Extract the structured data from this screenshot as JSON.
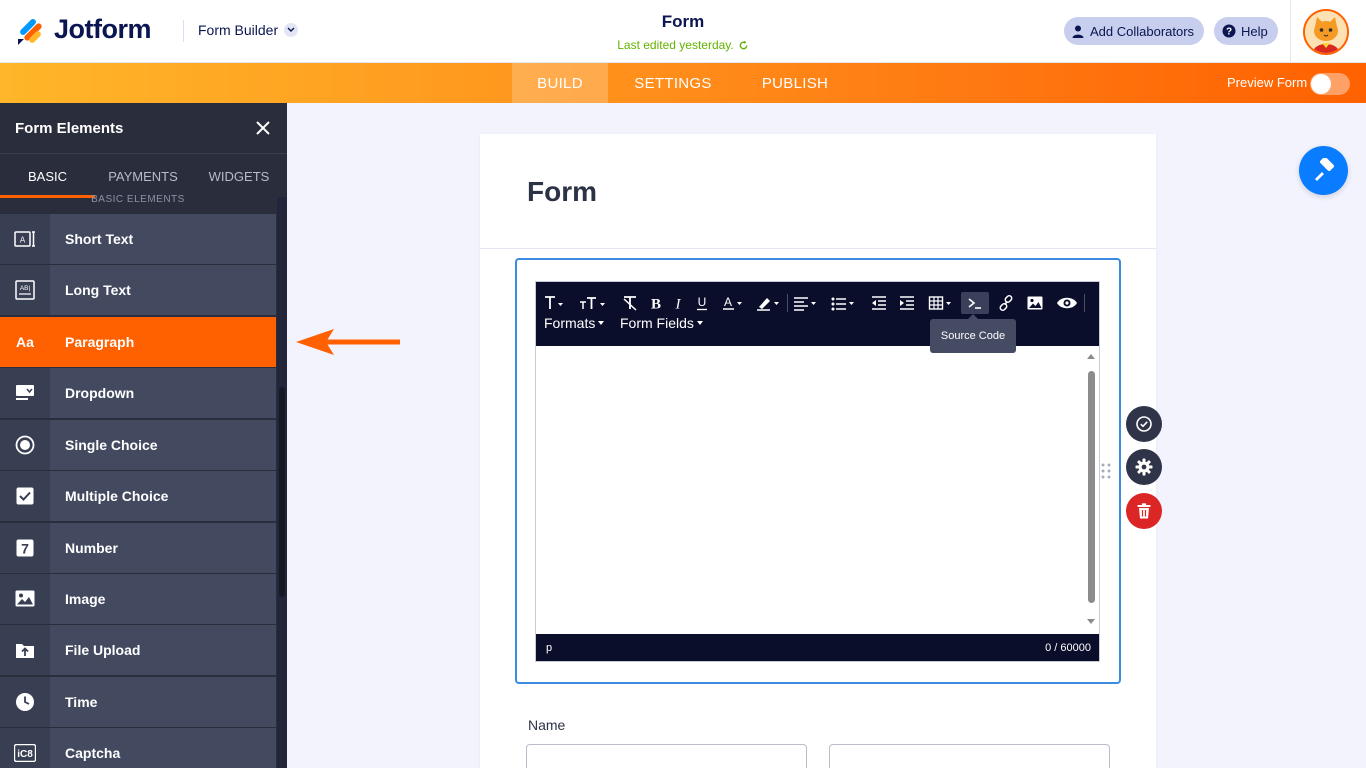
{
  "header": {
    "brand": "Jotform",
    "builder_label": "Form Builder",
    "form_title": "Form",
    "last_edited": "Last edited yesterday.",
    "add_collaborators": "Add Collaborators",
    "help": "Help"
  },
  "nav": {
    "tabs": [
      {
        "label": "BUILD",
        "active": true
      },
      {
        "label": "SETTINGS",
        "active": false
      },
      {
        "label": "PUBLISH",
        "active": false
      }
    ],
    "preview_label": "Preview Form",
    "preview_enabled": false
  },
  "sidebar": {
    "title": "Form Elements",
    "tabs": [
      {
        "label": "BASIC",
        "active": true
      },
      {
        "label": "PAYMENTS",
        "active": false
      },
      {
        "label": "WIDGETS",
        "active": false
      }
    ],
    "section_label": "BASIC ELEMENTS",
    "items": [
      {
        "label": "Short Text",
        "icon": "short-text-icon"
      },
      {
        "label": "Long Text",
        "icon": "long-text-icon"
      },
      {
        "label": "Paragraph",
        "icon": "paragraph-icon",
        "active": true
      },
      {
        "label": "Dropdown",
        "icon": "dropdown-icon"
      },
      {
        "label": "Single Choice",
        "icon": "radio-icon"
      },
      {
        "label": "Multiple Choice",
        "icon": "checkbox-icon"
      },
      {
        "label": "Number",
        "icon": "number-icon"
      },
      {
        "label": "Image",
        "icon": "image-icon"
      },
      {
        "label": "File Upload",
        "icon": "upload-icon"
      },
      {
        "label": "Time",
        "icon": "clock-icon"
      },
      {
        "label": "Captcha",
        "icon": "captcha-icon"
      }
    ]
  },
  "form": {
    "heading": "Form",
    "editor": {
      "menus": [
        "Formats",
        "Form Fields"
      ],
      "tooltip": "Source Code",
      "status_tag": "p",
      "char_count": "0 / 60000"
    },
    "name_label": "Name"
  },
  "colors": {
    "accent": "#ff6100",
    "sidebar_bg": "#292d3c",
    "toolbar_bg": "#0b0e2b",
    "selection": "#3b8be0",
    "delete": "#dc2626",
    "fab": "#0a7cff"
  }
}
